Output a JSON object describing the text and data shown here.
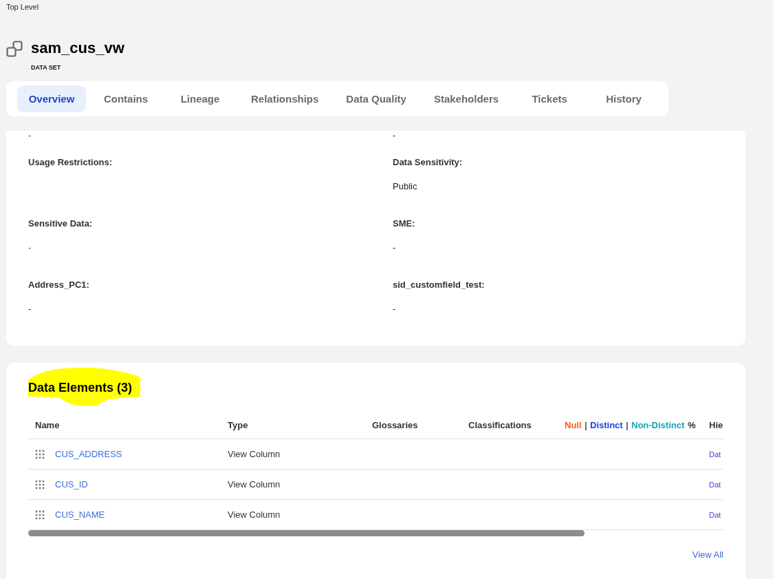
{
  "breadcrumb": "Top Level",
  "header": {
    "title": "sam_cus_vw",
    "subtitle": "DATA SET"
  },
  "tabs": [
    {
      "label": "Overview",
      "selected": true
    },
    {
      "label": "Contains",
      "selected": false
    },
    {
      "label": "Lineage",
      "selected": false
    },
    {
      "label": "Relationships",
      "selected": false
    },
    {
      "label": "Data Quality",
      "selected": false
    },
    {
      "label": "Stakeholders",
      "selected": false
    },
    {
      "label": "Tickets",
      "selected": false
    },
    {
      "label": "History",
      "selected": false
    }
  ],
  "overview": {
    "fields": [
      {
        "value": "-",
        "kind": "link"
      },
      {
        "value": "-",
        "kind": "text"
      },
      {
        "label": "Usage Restrictions:"
      },
      {
        "label": "Data Sensitivity:",
        "value": "Public",
        "kind": "text"
      },
      {
        "label": "Sensitive Data:",
        "value": "-",
        "kind": "link"
      },
      {
        "label": "SME:",
        "value": "-",
        "kind": "text"
      },
      {
        "label": "Address_PC1:",
        "value": "-",
        "kind": "text"
      },
      {
        "label": "sid_customfield_test:",
        "value": "-",
        "kind": "text"
      }
    ]
  },
  "data_elements": {
    "title": "Data Elements (3)",
    "highlighted": true,
    "table": {
      "columns": [
        {
          "label": "Name"
        },
        {
          "label": "Type"
        },
        {
          "label": "Glossaries"
        },
        {
          "label": "Classifications"
        },
        {
          "parts": [
            {
              "text": "Null",
              "color": "#ff5c0a"
            },
            {
              "text": "|",
              "color": "#555555"
            },
            {
              "text": "Distinct",
              "color": "#1f3fd6"
            },
            {
              "text": "|",
              "color": "#555555"
            },
            {
              "text": "Non-Distinct",
              "color": "#14a3b5"
            },
            {
              "text": "%",
              "color": "#333333"
            }
          ]
        },
        {
          "label": "Hie"
        }
      ],
      "rows": [
        {
          "name": "CUS_ADDRESS",
          "type": "View Column",
          "column_6": "Dat"
        },
        {
          "name": "CUS_ID",
          "type": "View Column",
          "column_6": "Dat"
        },
        {
          "name": "CUS_NAME",
          "type": "View Column",
          "column_6": "Dat"
        }
      ]
    },
    "view_all": "View All"
  }
}
